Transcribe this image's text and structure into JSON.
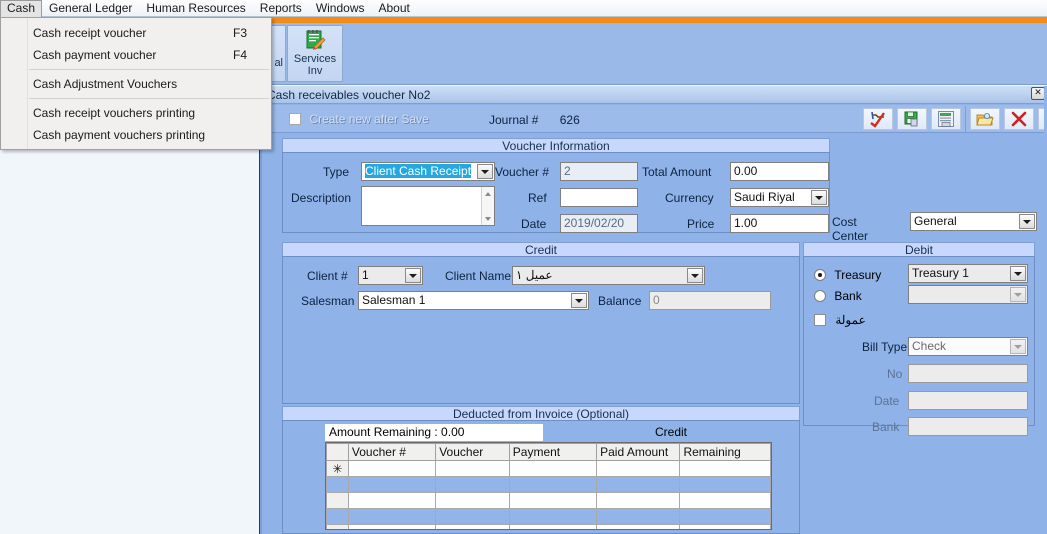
{
  "menubar": {
    "items": [
      {
        "label": "Cash",
        "active": true
      },
      {
        "label": "General Ledger",
        "active": false
      },
      {
        "label": "Human Resources",
        "active": false
      },
      {
        "label": "Reports",
        "active": false
      },
      {
        "label": "Windows",
        "active": false
      },
      {
        "label": "About",
        "active": false
      }
    ]
  },
  "dropdown": {
    "items": [
      {
        "label": "Cash receipt voucher",
        "shortcut": "F3"
      },
      {
        "label": "Cash payment voucher",
        "shortcut": "F4"
      },
      {
        "label": "Cash Adjustment Vouchers",
        "shortcut": ""
      },
      {
        "label": "Cash receipt vouchers printing",
        "shortcut": ""
      },
      {
        "label": "Cash payment vouchers printing",
        "shortcut": ""
      }
    ]
  },
  "ribbon": {
    "partial_button_label": "al",
    "services_button": {
      "line1": "Services",
      "line2": "Inv",
      "icon": "services-invoice-icon"
    }
  },
  "window": {
    "title": "Cash receivables voucher No2",
    "close_icon": "close-icon"
  },
  "header": {
    "create_new_label": "Create new after Save",
    "journal_label": "Journal #",
    "journal_value": "626",
    "toolbar": [
      {
        "name": "approve-icon"
      },
      {
        "name": "save-icon"
      },
      {
        "name": "save-print-icon"
      },
      {
        "name": "open-folder-icon"
      },
      {
        "name": "delete-icon"
      },
      {
        "name": "exit-icon"
      }
    ]
  },
  "voucher_info": {
    "caption": "Voucher Information",
    "type_label": "Type",
    "type_value": "Client Cash Receipt",
    "description_label": "Description",
    "description_value": "",
    "voucher_no_label": "Voucher #",
    "voucher_no_value": "2",
    "ref_label": "Ref",
    "ref_value": "",
    "date_label": "Date",
    "date_value": "2019/02/20",
    "total_amount_label": "Total Amount",
    "total_amount_value": "0.00",
    "currency_label": "Currency",
    "currency_value": "Saudi Riyal",
    "price_label": "Price",
    "price_value": "1.00"
  },
  "cost_center": {
    "label": "Cost Center",
    "value": "General"
  },
  "credit": {
    "caption": "Credit",
    "client_no_label": "Client #",
    "client_no_value": "1",
    "client_name_label": "Client Name",
    "client_name_value": "عميل ١",
    "salesman_label": "Salesman",
    "salesman_value": "Salesman 1",
    "balance_label": "Balance",
    "balance_value": "0"
  },
  "debit": {
    "caption": "Debit",
    "treasury_label": "Treasury",
    "treasury_selected": true,
    "treasury_value": "Treasury 1",
    "bank_label": "Bank",
    "bank_selected": false,
    "bank_value": "",
    "commission_label": "عمولة",
    "commission_checked": false,
    "bill_type_label": "Bill Type",
    "bill_type_value": "Check",
    "no_label": "No",
    "no_value": "",
    "date_label": "Date",
    "date_value": "",
    "bank2_label": "Bank",
    "bank2_value": ""
  },
  "invoice": {
    "caption": "Deducted from Invoice (Optional)",
    "amount_remaining_label": "Amount Remaining : 0.00",
    "credit_label": "Credit",
    "columns": [
      "Voucher #",
      "Voucher",
      "Payment",
      "Paid Amount",
      "Remaining"
    ],
    "new_row_marker": "✳",
    "rows": [
      {
        "marker": "✳",
        "cells": [
          "",
          "",
          "",
          "",
          ""
        ]
      },
      {
        "marker": "",
        "cells": [
          "",
          "",
          "",
          "",
          ""
        ]
      },
      {
        "marker": "",
        "cells": [
          "",
          "",
          "",
          "",
          ""
        ]
      },
      {
        "marker": "",
        "cells": [
          "",
          "",
          "",
          "",
          ""
        ]
      },
      {
        "marker": "",
        "cells": [
          "",
          "",
          "",
          "",
          ""
        ]
      }
    ]
  },
  "colors": {
    "panel_blue": "#8fb2e8",
    "caption_blue": "#c8d8fc",
    "ribbon_orange": "#f28c17",
    "selection_cyan": "#25a8e0"
  }
}
